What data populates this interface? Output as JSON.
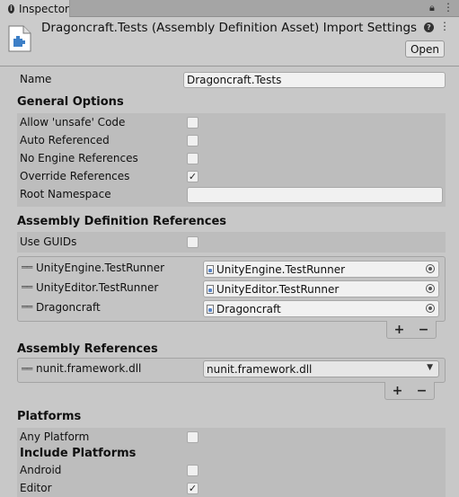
{
  "tab": {
    "label": "Inspector",
    "icon": "info-icon"
  },
  "header": {
    "title": "Dragoncraft.Tests (Assembly Definition Asset) Import Settings",
    "open_label": "Open"
  },
  "name_row": {
    "label": "Name",
    "value": "Dragoncraft.Tests"
  },
  "general": {
    "title": "General Options",
    "allow_unsafe": {
      "label": "Allow 'unsafe' Code",
      "checked": false
    },
    "auto_referenced": {
      "label": "Auto Referenced",
      "checked": false
    },
    "no_engine_refs": {
      "label": "No Engine References",
      "checked": false
    },
    "override_refs": {
      "label": "Override References",
      "checked": true
    },
    "root_namespace": {
      "label": "Root Namespace",
      "value": ""
    }
  },
  "asmdef_refs": {
    "title": "Assembly Definition References",
    "use_guids": {
      "label": "Use GUIDs",
      "checked": false
    },
    "items": [
      {
        "label": "UnityEngine.TestRunner",
        "value": "UnityEngine.TestRunner"
      },
      {
        "label": "UnityEditor.TestRunner",
        "value": "UnityEditor.TestRunner"
      },
      {
        "label": "Dragoncraft",
        "value": "Dragoncraft"
      }
    ],
    "add_label": "+",
    "remove_label": "−"
  },
  "assembly_refs": {
    "title": "Assembly References",
    "items": [
      {
        "label": "nunit.framework.dll",
        "value": "nunit.framework.dll"
      }
    ],
    "add_label": "+",
    "remove_label": "−"
  },
  "platforms": {
    "title": "Platforms",
    "any_platform": {
      "label": "Any Platform",
      "checked": false
    },
    "include_title": "Include Platforms",
    "android": {
      "label": "Android",
      "checked": false
    },
    "editor": {
      "label": "Editor",
      "checked": true
    }
  },
  "check_glyph": "✓"
}
